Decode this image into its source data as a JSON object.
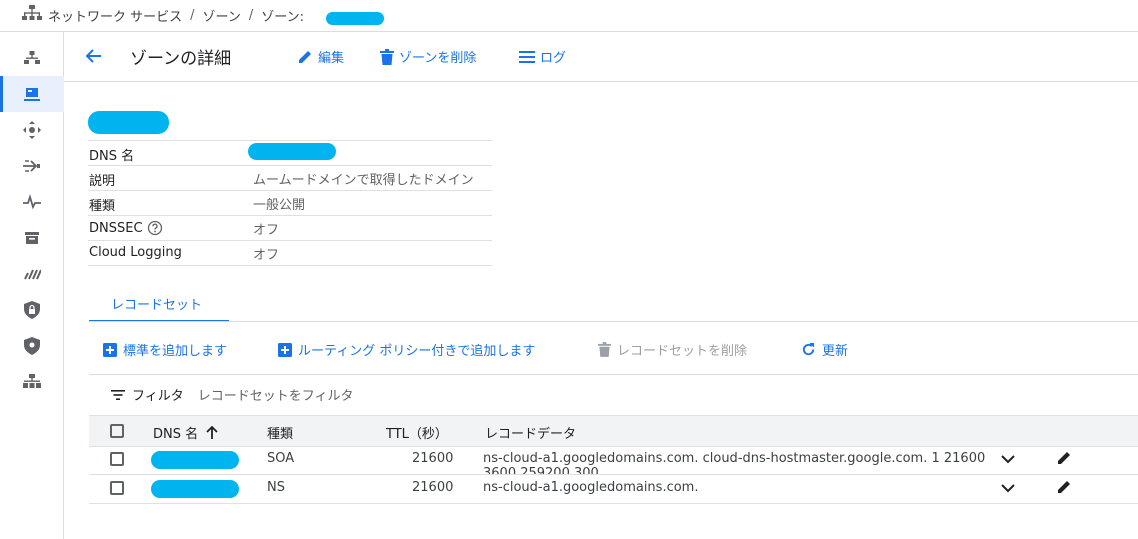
{
  "breadcrumb": {
    "items": [
      "ネットワーク サービス",
      "ゾーン",
      "ゾーン: "
    ],
    "separator": "/"
  },
  "header": {
    "back_icon": "arrow-left-icon",
    "title": "ゾーンの詳細",
    "edit_label": "編集",
    "delete_zone_label": "ゾーンを削除",
    "log_label": "ログ"
  },
  "details": {
    "rows": [
      {
        "key": "DNS 名",
        "value": ""
      },
      {
        "key": "説明",
        "value": "ムームードメインで取得したドメイン"
      },
      {
        "key": "種類",
        "value": "一般公開"
      },
      {
        "key": "DNSSEC",
        "value": "オフ"
      },
      {
        "key": "Cloud Logging",
        "value": "オフ"
      }
    ]
  },
  "tabs": {
    "record_sets": "レコードセット"
  },
  "actions": {
    "add_standard": "標準を追加します",
    "add_routing": "ルーティング ポリシー付きで追加します",
    "delete_record_set": "レコードセットを削除",
    "refresh": "更新"
  },
  "filter": {
    "label": "フィルタ",
    "placeholder": "レコードセットをフィルタ"
  },
  "table": {
    "columns": {
      "dns_name": "DNS 名",
      "type": "種類",
      "ttl": "TTL（秒）",
      "data": "レコードデータ"
    },
    "rows": [
      {
        "type": "SOA",
        "ttl": "21600",
        "data": "ns-cloud-a1.googledomains.com. cloud-dns-hostmaster.google.com. 1 21600",
        "overflow": "3600 259200 300"
      },
      {
        "type": "NS",
        "ttl": "21600",
        "data": "ns-cloud-a1.googledomains.com.",
        "overflow": ""
      }
    ]
  },
  "colors": {
    "accent": "#1a73e8",
    "redaction": "#00b4f0",
    "disabled": "#9aa0a6"
  }
}
